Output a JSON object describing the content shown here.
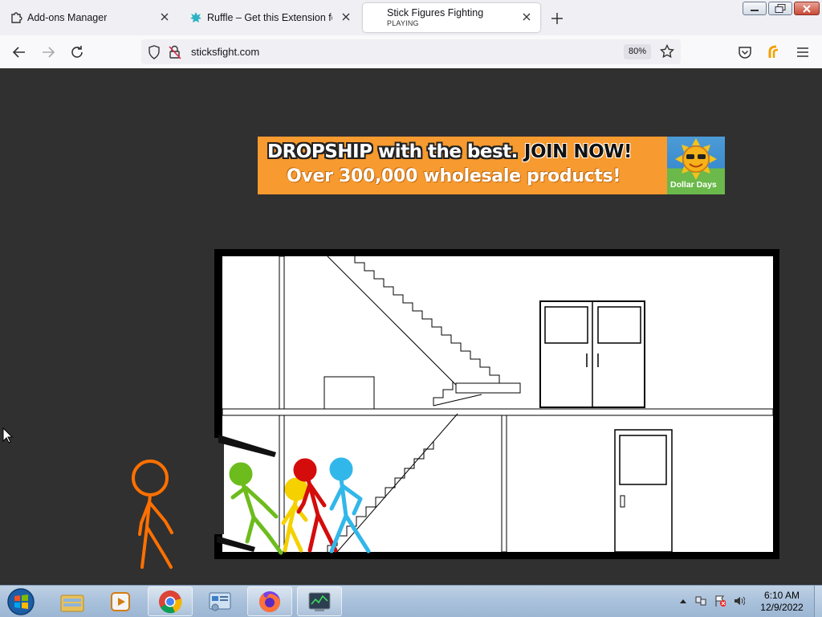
{
  "browser": {
    "tabs": [
      {
        "title": "Add-ons Manager",
        "icon": "puzzle-icon",
        "active": false
      },
      {
        "title": "Ruffle – Get this Extension for 🦊",
        "icon": "ruffle-icon",
        "active": false
      },
      {
        "title": "Stick Figures Fighting",
        "subtitle": "PLAYING",
        "active": true
      }
    ],
    "new_tab_icon": "plus-icon",
    "address": "sticksfight.com",
    "zoom": "80%",
    "nav_icons": [
      "back-arrow-icon",
      "forward-arrow-icon",
      "reload-icon",
      "shield-icon",
      "lock-slash-icon",
      "bookmark-star-icon",
      "pocket-icon",
      "ruffle-extension-icon",
      "hamburger-menu-icon"
    ]
  },
  "ad": {
    "line1": "DROPSHIP with the best.",
    "line1_cta": "JOIN NOW!",
    "line2": "Over 300,000 wholesale products!",
    "logo_text": "Dollar Days",
    "colors": {
      "background": "#f79a2f"
    }
  },
  "game": {
    "title": "Stick Figures Fighting",
    "figures": [
      {
        "color": "#ff7000",
        "name": "orange"
      },
      {
        "color": "#6dbc1d",
        "name": "green"
      },
      {
        "color": "#f5d100",
        "name": "yellow"
      },
      {
        "color": "#d40c0c",
        "name": "red"
      },
      {
        "color": "#32b7ea",
        "name": "blue"
      }
    ]
  },
  "taskbar": {
    "items": [
      "start-orb-icon",
      "windows-explorer-icon",
      "media-player-icon",
      "chrome-icon",
      "control-panel-icon",
      "firefox-icon",
      "task-manager-icon"
    ],
    "time": "6:10 AM",
    "date": "12/9/2022"
  }
}
